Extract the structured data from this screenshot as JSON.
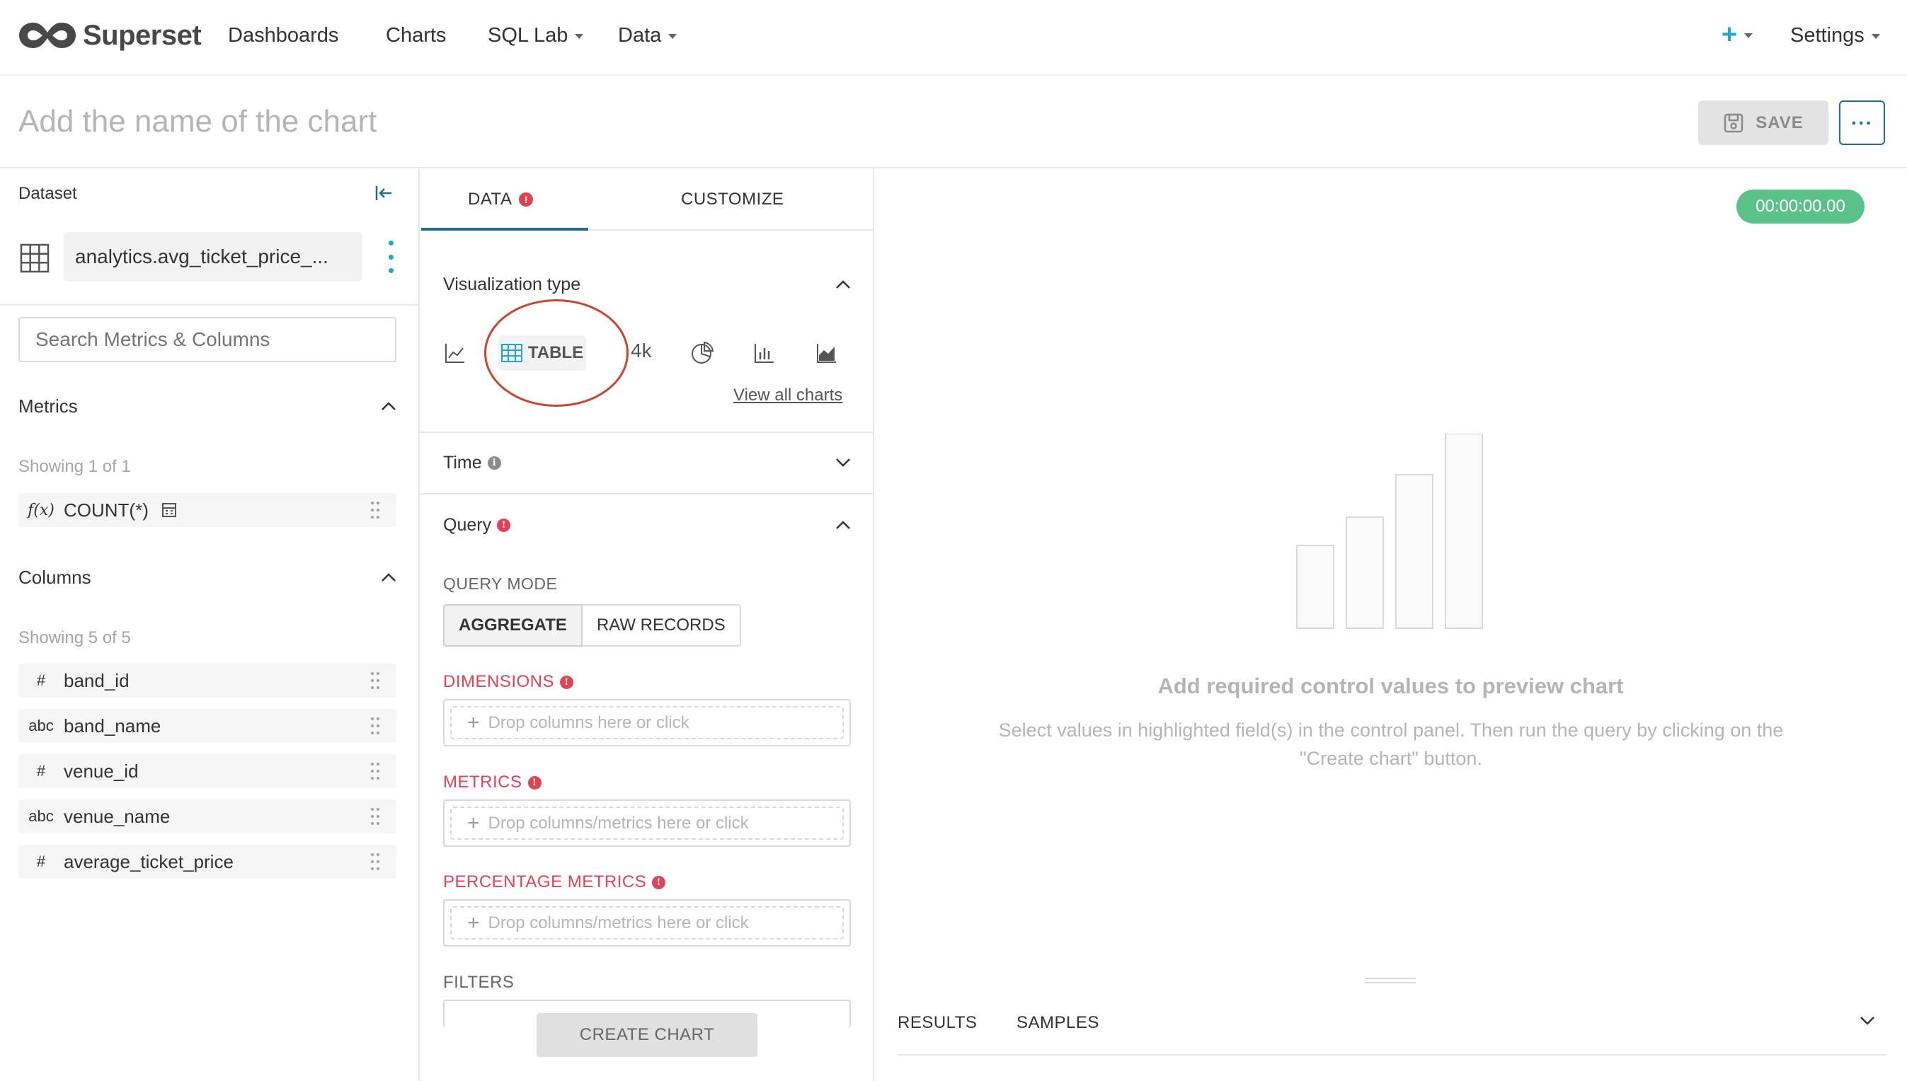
{
  "brand": {
    "name": "Superset"
  },
  "nav": {
    "items": [
      {
        "label": "Dashboards",
        "has_caret": false
      },
      {
        "label": "Charts",
        "has_caret": false
      },
      {
        "label": "SQL Lab",
        "has_caret": true
      },
      {
        "label": "Data",
        "has_caret": true
      }
    ],
    "plus_icon": "plus-icon",
    "settings": "Settings"
  },
  "title_row": {
    "chart_name_placeholder": "Add the name of the chart",
    "save_label": "SAVE",
    "more_label": "···"
  },
  "dataset_panel": {
    "label": "Dataset",
    "dataset_name": "analytics.avg_ticket_price_...",
    "search_placeholder": "Search Metrics & Columns",
    "metrics": {
      "title": "Metrics",
      "showing": "Showing 1 of 1",
      "items": [
        {
          "type": "f(x)",
          "name": "COUNT(*)"
        }
      ]
    },
    "columns": {
      "title": "Columns",
      "showing": "Showing 5 of 5",
      "items": [
        {
          "type": "#",
          "name": "band_id"
        },
        {
          "type": "abc",
          "name": "band_name"
        },
        {
          "type": "#",
          "name": "venue_id"
        },
        {
          "type": "abc",
          "name": "venue_name"
        },
        {
          "type": "#",
          "name": "average_ticket_price"
        }
      ]
    }
  },
  "control_panel": {
    "tabs": [
      {
        "label": "DATA",
        "error": "!"
      },
      {
        "label": "CUSTOMIZE"
      }
    ],
    "viz": {
      "title": "Visualization type",
      "selected": "TABLE",
      "big_number": "4k",
      "view_all": "View all charts"
    },
    "time": {
      "title": "Time",
      "info": "i"
    },
    "query": {
      "title": "Query",
      "info": "!"
    },
    "query_mode": {
      "label": "QUERY MODE",
      "options": [
        "AGGREGATE",
        "RAW RECORDS"
      ],
      "selected": "AGGREGATE"
    },
    "fields": [
      {
        "label": "DIMENSIONS",
        "placeholder": "Drop columns here or click"
      },
      {
        "label": "METRICS",
        "placeholder": "Drop columns/metrics here or click"
      },
      {
        "label": "PERCENTAGE METRICS",
        "placeholder": "Drop columns/metrics here or click"
      }
    ],
    "filters_label": "FILTERS",
    "create_chart": "CREATE CHART"
  },
  "preview": {
    "timer": "00:00:00.00",
    "empty_title": "Add required control values to preview chart",
    "empty_desc": "Select values in highlighted field(s) in the control panel. Then run the query by clicking on the \"Create chart\" button.",
    "result_tabs": [
      "RESULTS",
      "SAMPLES"
    ]
  },
  "colors": {
    "brand_accent": "#20a7c9",
    "primary": "#1f6f8b",
    "error": "#e04355",
    "success": "#5ac189",
    "annotation": "#c9452f"
  }
}
